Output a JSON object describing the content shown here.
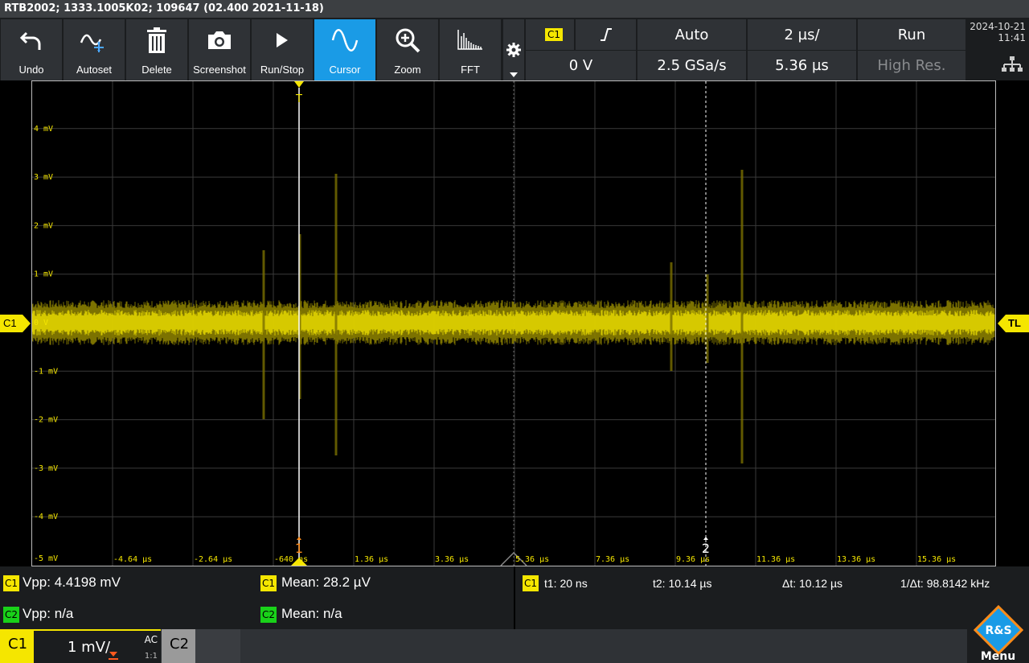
{
  "titlebar": {
    "text": "RTB2002; 1333.1005K02; 109647 (02.400 2021-11-18)"
  },
  "toolbar": {
    "buttons": [
      {
        "label": "Undo",
        "icon": "undo-icon"
      },
      {
        "label": "Autoset",
        "icon": "autoset-icon"
      },
      {
        "label": "Delete",
        "icon": "trash-icon"
      },
      {
        "label": "Screenshot",
        "icon": "camera-icon"
      },
      {
        "label": "Run/Stop",
        "icon": "play-icon"
      },
      {
        "label": "Cursor",
        "icon": "cursor-wave-icon"
      },
      {
        "label": "Zoom",
        "icon": "zoom-icon"
      },
      {
        "label": "FFT",
        "icon": "fft-icon"
      }
    ]
  },
  "trigger": {
    "source": "C1",
    "level": "0 V",
    "mode": "Auto",
    "sample_rate": "2.5 GSa/s",
    "timebase": "2 µs/",
    "position": "5.36 µs",
    "run_state": "Run",
    "acq_mode": "High Res."
  },
  "datetime": {
    "date": "2024-10-21",
    "time": "11:41"
  },
  "scope": {
    "y_labels": [
      "4 mV",
      "3 mV",
      "2 mV",
      "1 mV",
      "0 V",
      "-1 mV",
      "-2 mV",
      "-3 mV",
      "-4 mV",
      "-5 mV"
    ],
    "x_labels": [
      "-4.64 µs",
      "-2.64 µs",
      "-640 ns",
      "1.36 µs",
      "3.36 µs",
      "5.36 µs",
      "7.36 µs",
      "9.36 µs",
      "11.36 µs",
      "13.36 µs",
      "15.36 µs"
    ],
    "left_marker": "C1",
    "right_marker": "TL",
    "cursor1_label": "1",
    "cursor2_label": "2",
    "trigger_marker_label": "T"
  },
  "measurements": {
    "c1_tag": "C1",
    "c2_tag": "C2",
    "c1_vpp": "Vpp: 4.4198 mV",
    "c1_mean": "Mean: 28.2 µV",
    "c2_vpp": "Vpp: n/a",
    "c2_mean": "Mean: n/a",
    "cursor_t1": "t1: 20 ns",
    "cursor_t2": "t2: 10.14 µs",
    "cursor_dt": "Δt: 10.12 µs",
    "cursor_freq": "1/Δt: 98.8142 kHz"
  },
  "channels": {
    "c1_label": "C1",
    "c1_scale": "1 mV/",
    "c1_coupling": "AC",
    "c1_probe": "1:1",
    "c2_label": "C2",
    "menu_label": "Menu"
  },
  "colors": {
    "channel1": "#f5e600",
    "channel2": "#19d219",
    "accent": "#1a9be6"
  }
}
